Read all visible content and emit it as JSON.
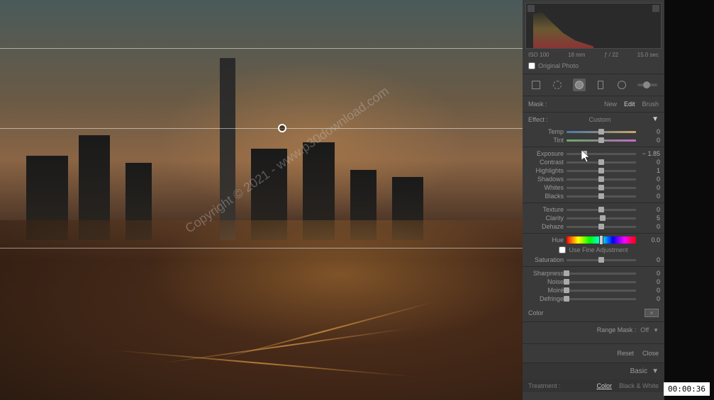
{
  "histogram": {
    "iso": "ISO 100",
    "focal": "18 mm",
    "aperture": "ƒ / 22",
    "shutter": "15.0 sec"
  },
  "original_photo_label": "Original Photo",
  "mask_section": {
    "label": "Mask :",
    "tabs": {
      "new": "New",
      "edit": "Edit",
      "brush": "Brush"
    }
  },
  "effect": {
    "label": "Effect :",
    "value": "Custom"
  },
  "sliders": {
    "temp": {
      "label": "Temp",
      "value": "0",
      "pos": 50
    },
    "tint": {
      "label": "Tint",
      "value": "0",
      "pos": 50
    },
    "exposure": {
      "label": "Exposure",
      "value": "− 1.85",
      "pos": 25
    },
    "contrast": {
      "label": "Contrast",
      "value": "0",
      "pos": 50
    },
    "highlights": {
      "label": "Highlights",
      "value": "1",
      "pos": 50
    },
    "shadows": {
      "label": "Shadows",
      "value": "0",
      "pos": 50
    },
    "whites": {
      "label": "Whites",
      "value": "0",
      "pos": 50
    },
    "blacks": {
      "label": "Blacks",
      "value": "0",
      "pos": 50
    },
    "texture": {
      "label": "Texture",
      "value": "0",
      "pos": 50
    },
    "clarity": {
      "label": "Clarity",
      "value": "5",
      "pos": 52
    },
    "dehaze": {
      "label": "Dehaze",
      "value": "0",
      "pos": 50
    },
    "hue": {
      "label": "Hue",
      "value": "0.0",
      "pos": 50
    },
    "saturation": {
      "label": "Saturation",
      "value": "0",
      "pos": 50
    },
    "sharpness": {
      "label": "Sharpness",
      "value": "0",
      "pos": 0
    },
    "noise": {
      "label": "Noise",
      "value": "0",
      "pos": 0
    },
    "moire": {
      "label": "Moiré",
      "value": "0",
      "pos": 0
    },
    "defringe": {
      "label": "Defringe",
      "value": "0",
      "pos": 0
    }
  },
  "fine_adjustment_label": "Use Fine Adjustment",
  "color_label": "Color",
  "range_mask": {
    "label": "Range Mask :",
    "value": "Off"
  },
  "actions": {
    "reset": "Reset",
    "close": "Close"
  },
  "basic_panel": "Basic",
  "treatment": {
    "label": "Treatment :",
    "color": "Color",
    "bw": "Black & White"
  },
  "watermark_text": "Copyright © 2021 - www.p30download.com",
  "timestamp": "00:00:36"
}
